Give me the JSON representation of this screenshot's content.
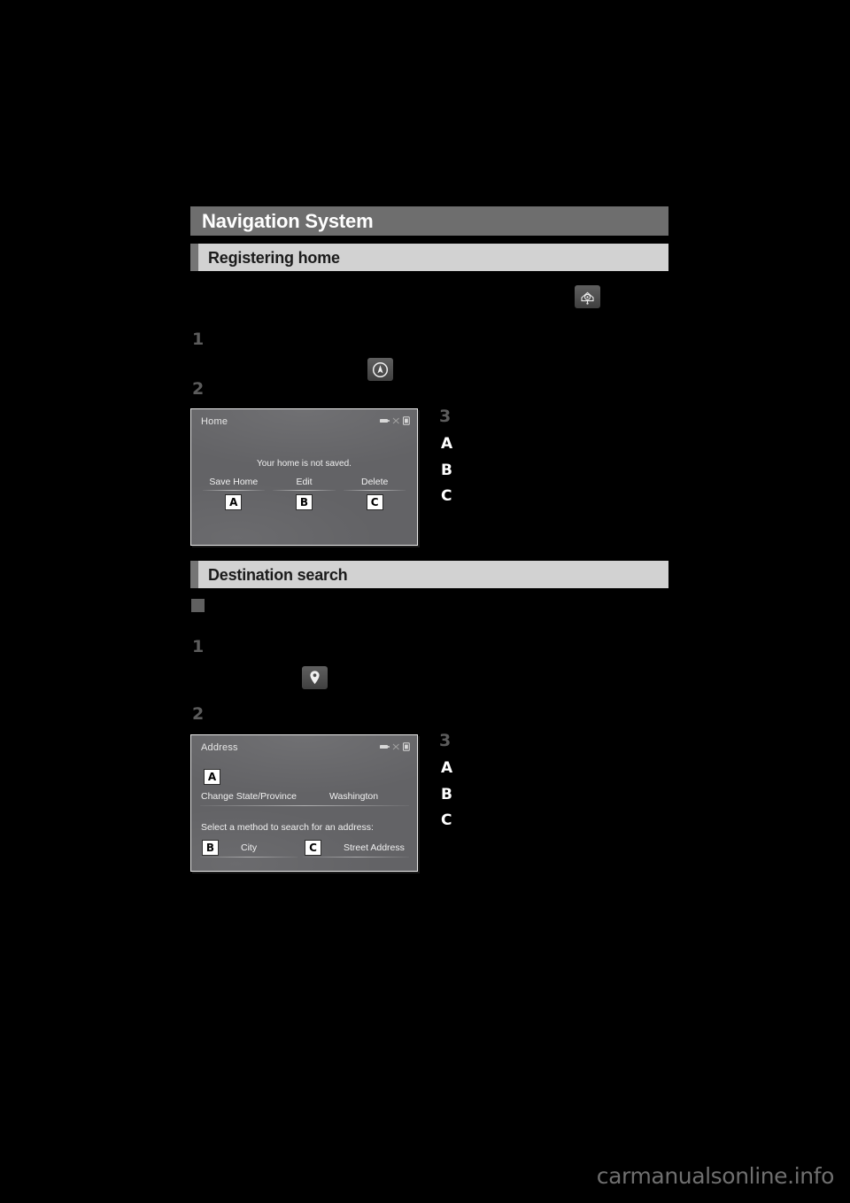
{
  "page": {
    "background_color": "#000000",
    "watermark": "carmanualsonline.info"
  },
  "chapter": {
    "title": "Navigation System",
    "bar_color": "#6e6e6e",
    "text_color": "#ffffff"
  },
  "sections": [
    {
      "id": "registering-home",
      "title": "Registering home",
      "bar_color": "#d2d2d2",
      "tab_color": "#757575",
      "steps": [
        "1",
        "2",
        "3"
      ],
      "icons": [
        {
          "name": "nav-settings-icon",
          "glyph": "map-setup"
        },
        {
          "name": "navigation-arrow-icon",
          "glyph": "compass-arrow"
        }
      ],
      "legend": [
        "A",
        "B",
        "C"
      ],
      "screenshot": {
        "name": "home-screen",
        "screen_title": "Home",
        "message": "Your home is not saved.",
        "buttons": [
          {
            "label": "Save Home",
            "callout": "A"
          },
          {
            "label": "Edit",
            "callout": "B"
          },
          {
            "label": "Delete",
            "callout": "C"
          }
        ],
        "status_icons": [
          "signal-icon",
          "bluetooth-icon",
          "battery-icon"
        ],
        "bg_color": "#636366"
      }
    },
    {
      "id": "destination-search",
      "title": "Destination search",
      "bar_color": "#d2d2d2",
      "tab_color": "#757575",
      "bullet": "square-bullet",
      "steps": [
        "1",
        "2",
        "3"
      ],
      "icons": [
        {
          "name": "map-pin-icon",
          "glyph": "destination-pin"
        }
      ],
      "legend": [
        "A",
        "B",
        "C"
      ],
      "screenshot": {
        "name": "address-screen",
        "screen_title": "Address",
        "change_state_label": "Change State/Province",
        "state_value": "Washington",
        "prompt": "Select a method to search for an address:",
        "callouts": {
          "state": "A",
          "city": "B",
          "street": "C"
        },
        "options": [
          {
            "label": "City",
            "callout": "B"
          },
          {
            "label": "Street Address",
            "callout": "C"
          }
        ],
        "status_icons": [
          "signal-icon",
          "bluetooth-icon",
          "battery-icon"
        ],
        "bg_color": "#636366"
      }
    }
  ]
}
